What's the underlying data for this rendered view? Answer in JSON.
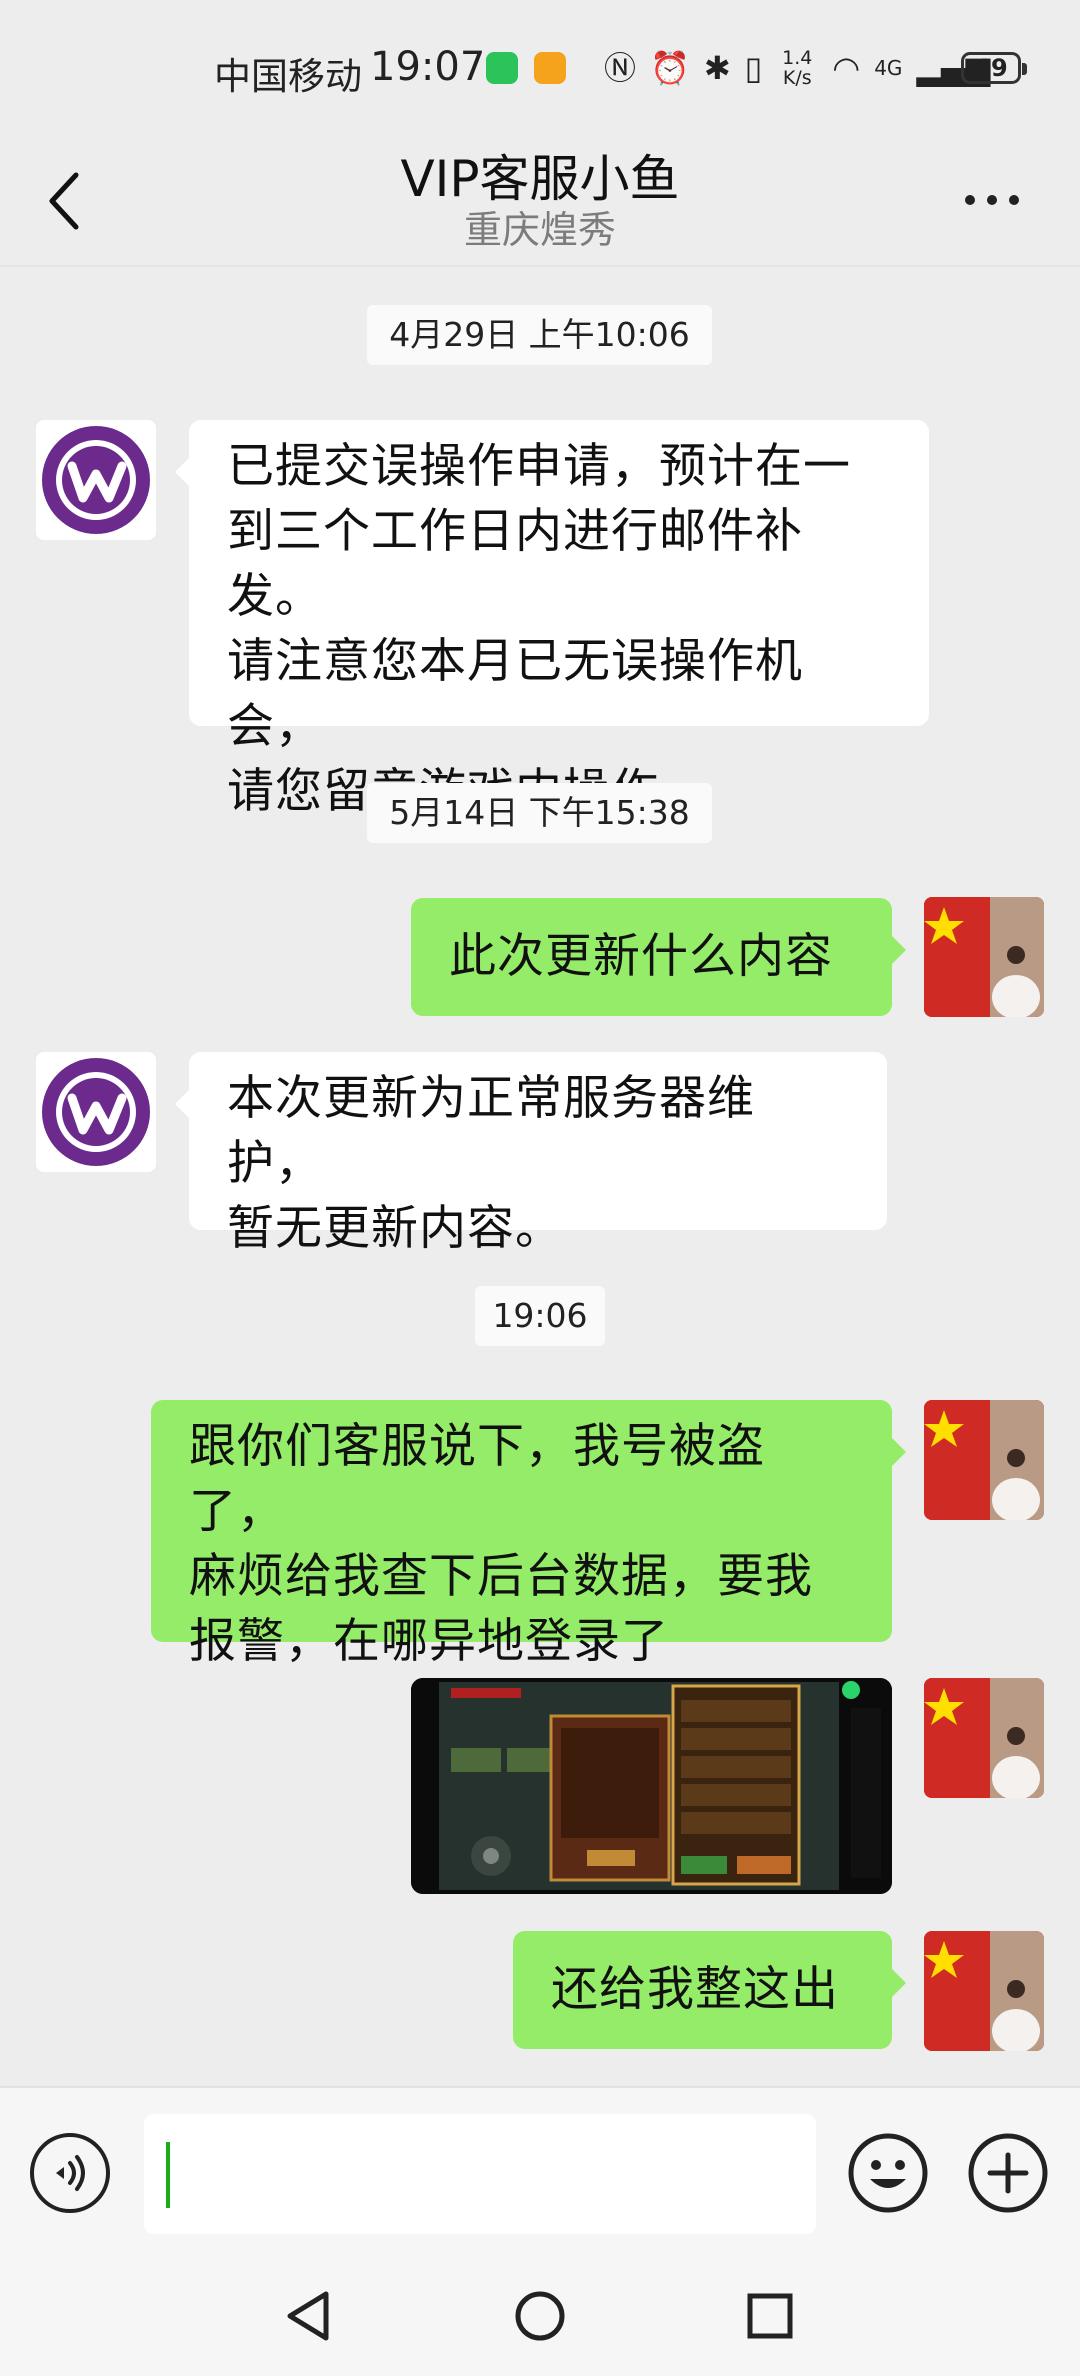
{
  "status_bar": {
    "carrier": "中国移动",
    "time": "19:07",
    "net_speed_value": "1.4",
    "net_speed_unit": "K/s",
    "network_type": "4G",
    "battery": "49"
  },
  "header": {
    "title": "VIP客服小鱼",
    "subtitle": "重庆煌秀"
  },
  "messages": [
    {
      "type": "time",
      "text": "4月29日 上午10:06"
    },
    {
      "type": "text",
      "direction": "in",
      "lines": [
        "已提交误操作申请，预计在一",
        "到三个工作日内进行邮件补发。",
        "请注意您本月已无误操作机会，",
        "请您留意游戏内操作。"
      ]
    },
    {
      "type": "time",
      "text": "5月14日 下午15:38"
    },
    {
      "type": "text",
      "direction": "out",
      "lines": [
        "此次更新什么内容"
      ]
    },
    {
      "type": "text",
      "direction": "in",
      "lines": [
        "本次更新为正常服务器维护，",
        "暂无更新内容。"
      ]
    },
    {
      "type": "time",
      "text": "19:06"
    },
    {
      "type": "text",
      "direction": "out",
      "lines": [
        "跟你们客服说下，我号被盗了，",
        "麻烦给我查下后台数据，要我",
        "报警，在哪异地登录了"
      ]
    },
    {
      "type": "image",
      "direction": "out",
      "icon": "game-screenshot-thumbnail"
    },
    {
      "type": "text",
      "direction": "out",
      "lines": [
        "还给我整这出"
      ]
    }
  ],
  "input_bar": {
    "value": "",
    "icons": [
      "voice-icon",
      "emoji-icon",
      "plus-icon"
    ]
  },
  "colors": {
    "background": "#ededed",
    "outgoing_bubble": "#95ec69",
    "incoming_bubble": "#ffffff",
    "accent_purple": "#6b2a8c"
  }
}
